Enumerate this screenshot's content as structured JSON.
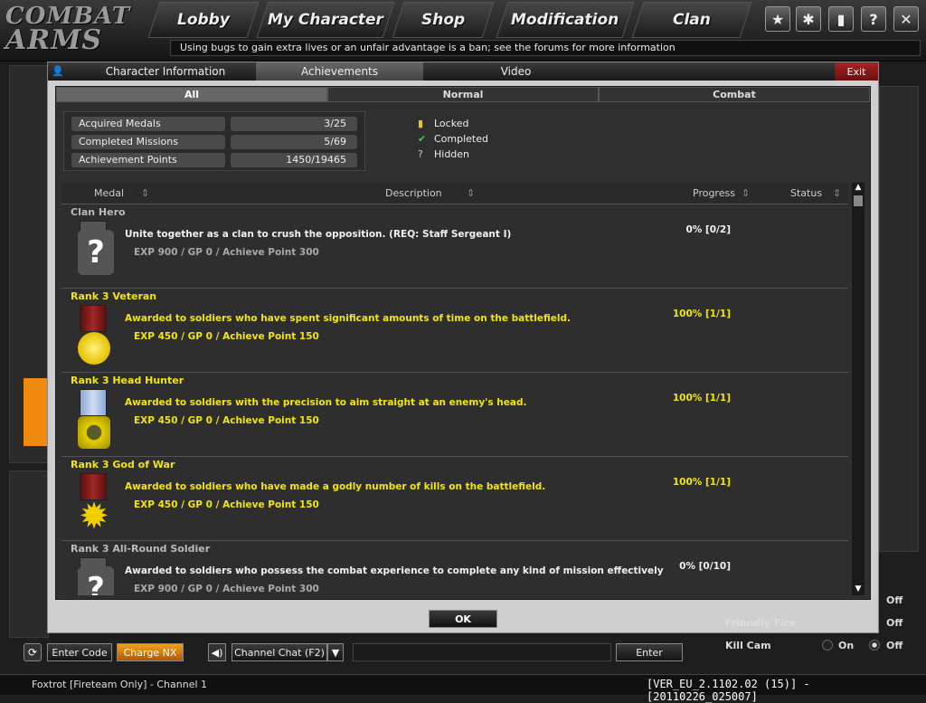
{
  "app": {
    "logo_line1": "COMBAT",
    "logo_line2": "ARMS"
  },
  "nav": {
    "tabs": [
      "Lobby",
      "My Character",
      "Shop",
      "Modification",
      "Clan"
    ],
    "icons": [
      "star-icon",
      "gear-icon",
      "lock-icon",
      "help-icon",
      "close-icon"
    ]
  },
  "notice": "Using bugs to gain extra lives or an unfair advantage is a ban; see the forums for more information",
  "dialog": {
    "tabs": [
      "Character Information",
      "Achievements",
      "Video"
    ],
    "exit": "Exit",
    "subtabs": [
      "All",
      "Normal",
      "Combat"
    ],
    "stats": [
      {
        "label": "Acquired Medals",
        "value": "3/25"
      },
      {
        "label": "Completed Missions",
        "value": "5/69"
      },
      {
        "label": "Achievement Points",
        "value": "1450/19465"
      }
    ],
    "legend": [
      {
        "symbol": "🔒",
        "label": "Locked"
      },
      {
        "symbol": "✔",
        "label": "Completed"
      },
      {
        "symbol": "?",
        "label": "Hidden"
      }
    ],
    "columns": [
      "Medal",
      "Description",
      "Progress",
      "Status"
    ],
    "rows": [
      {
        "title": "Clan Hero",
        "desc": "Unite together as a clan to crush the opposition. (REQ: Staff Sergeant I)",
        "exp": "EXP 900 / GP 0 / Achieve Point 300",
        "progress": "0% [0/2]",
        "completed": false
      },
      {
        "title": "Rank 3 Veteran",
        "desc": "Awarded to soldiers who have spent significant amounts of time on the battlefield.",
        "exp": "EXP 450 / GP 0 / Achieve Point 150",
        "progress": "100% [1/1]",
        "completed": true
      },
      {
        "title": "Rank 3 Head Hunter",
        "desc": "Awarded to soldiers with the precision to aim straight at an enemy's head.",
        "exp": "EXP 450 / GP 0 / Achieve Point 150",
        "progress": "100% [1/1]",
        "completed": true
      },
      {
        "title": "Rank 3 God of War",
        "desc": "Awarded to soldiers who have made a godly number of kills on the battlefield.",
        "exp": "EXP 450 / GP 0 / Achieve Point 150",
        "progress": "100% [1/1]",
        "completed": true
      },
      {
        "title": "Rank 3 All-Round Soldier",
        "desc": "Awarded to soldiers who possess the combat experience to complete any kind of mission effectively",
        "exp": "EXP 900 / GP 0 / Achieve Point 300",
        "progress": "0% [0/10]",
        "completed": false
      }
    ],
    "ok": "OK"
  },
  "bottom": {
    "enter_code": "Enter Code",
    "charge_nx": "Charge NX",
    "channel_chat": "Channel Chat (F2)",
    "enter": "Enter",
    "status": "Foxtrot [Fireteam Only] - Channel 1",
    "version": "[VER_EU_2.1102.02 (15)] - [20110226_025007]"
  },
  "options": {
    "friendly_fire": "Friendly Fire",
    "kill_cam": "Kill Cam",
    "on": "On",
    "off": "Off"
  }
}
